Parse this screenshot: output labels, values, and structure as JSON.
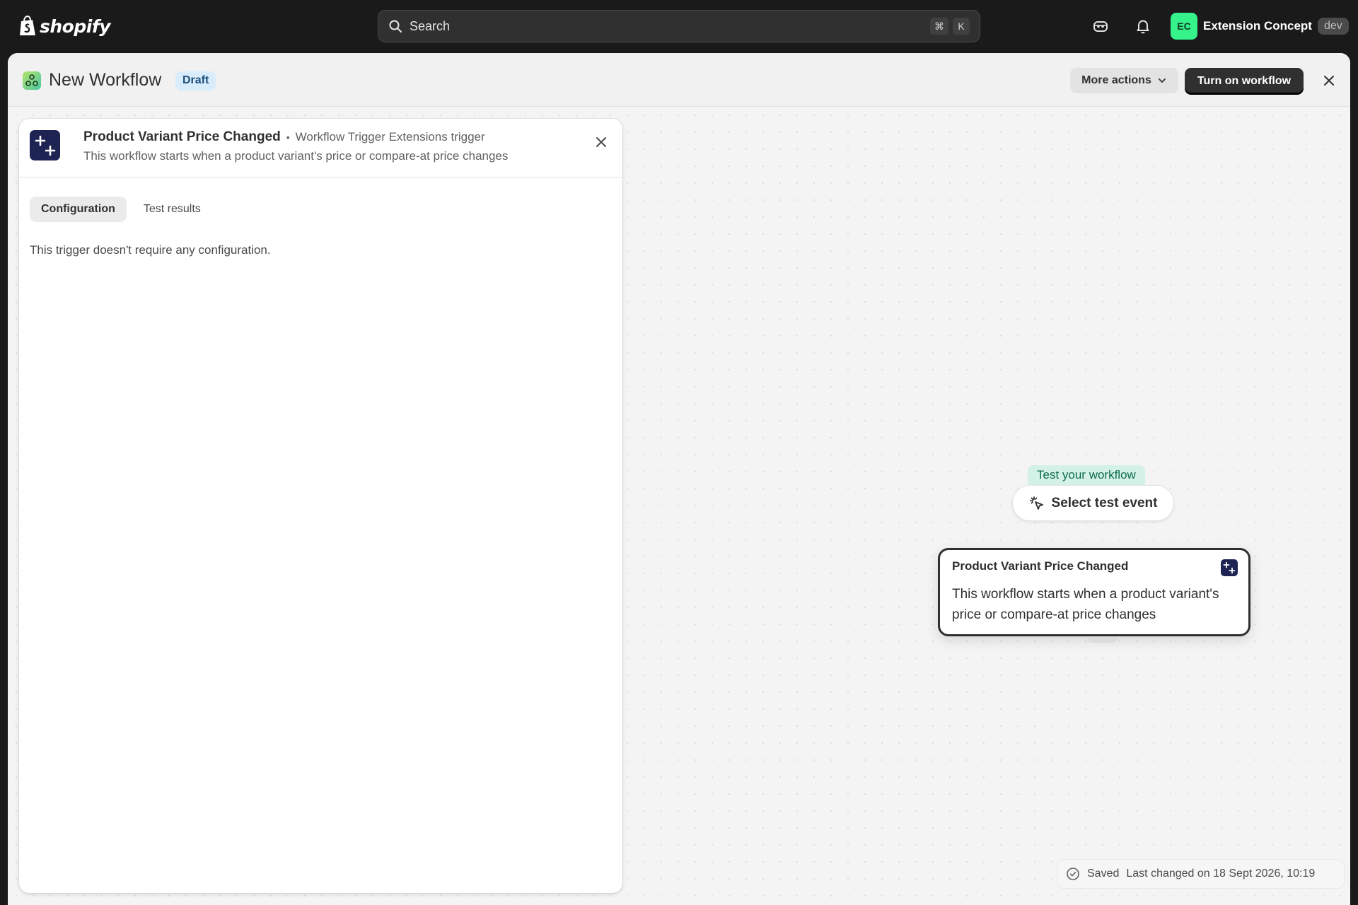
{
  "topbar": {
    "brand": "shopify",
    "search_placeholder": "Search",
    "shortcut_cmd": "⌘",
    "shortcut_key": "K",
    "account_initials": "EC",
    "account_name": "Extension Concept",
    "account_badge": "dev"
  },
  "header": {
    "title": "New Workflow",
    "status_badge": "Draft",
    "more_actions_label": "More actions",
    "turn_on_label": "Turn on workflow"
  },
  "panel": {
    "trigger_title": "Product Variant Price Changed",
    "separator": "•",
    "trigger_source": "Workflow Trigger Extensions trigger",
    "trigger_description": "This workflow starts when a product variant's price or compare-at price changes",
    "tabs": [
      {
        "label": "Configuration",
        "active": true
      },
      {
        "label": "Test results",
        "active": false
      }
    ],
    "config_message": "This trigger doesn't require any configuration."
  },
  "canvas": {
    "test_label": "Test your workflow",
    "select_test_label": "Select test event",
    "node": {
      "title": "Product Variant Price Changed",
      "description": "This workflow starts when a product variant's price or compare-at price changes"
    },
    "saved_label": "Saved",
    "last_changed": "Last changed on 18 Sept 2026, 10:19"
  },
  "icons": {
    "search": "search-icon",
    "alerts": "bell-icon",
    "sidekick": "sidekick-icon",
    "close": "close-icon",
    "chevron": "chevron-down-icon",
    "trigger": "trigger-plus-icon",
    "select": "cursor-click-icon",
    "saved": "check-circle-icon"
  },
  "colors": {
    "topbar_bg": "#1a1a1a",
    "primary_button": "#303030",
    "avatar": "#36f28b",
    "draft_badge": "#d8ecfb",
    "trigger_icon_bg": "#1d2352",
    "test_pill": "#d4f1e8"
  }
}
